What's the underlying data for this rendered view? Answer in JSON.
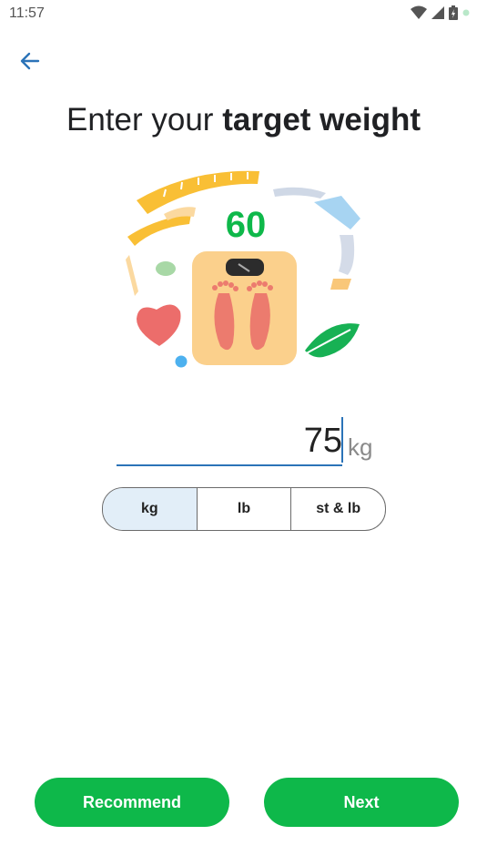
{
  "status": {
    "time": "11:57"
  },
  "title": {
    "prefix": "Enter your ",
    "bold": "target weight"
  },
  "illustration": {
    "scale_number": "60"
  },
  "weight": {
    "value": "75",
    "unit_suffix": "kg"
  },
  "units": [
    {
      "label": "kg",
      "active": true
    },
    {
      "label": "lb",
      "active": false
    },
    {
      "label": "st & lb",
      "active": false
    }
  ],
  "buttons": {
    "recommend": "Recommend",
    "next": "Next"
  },
  "colors": {
    "accent": "#0eb84a",
    "blue": "#2b73b8",
    "segment_active": "#e2eef8"
  }
}
